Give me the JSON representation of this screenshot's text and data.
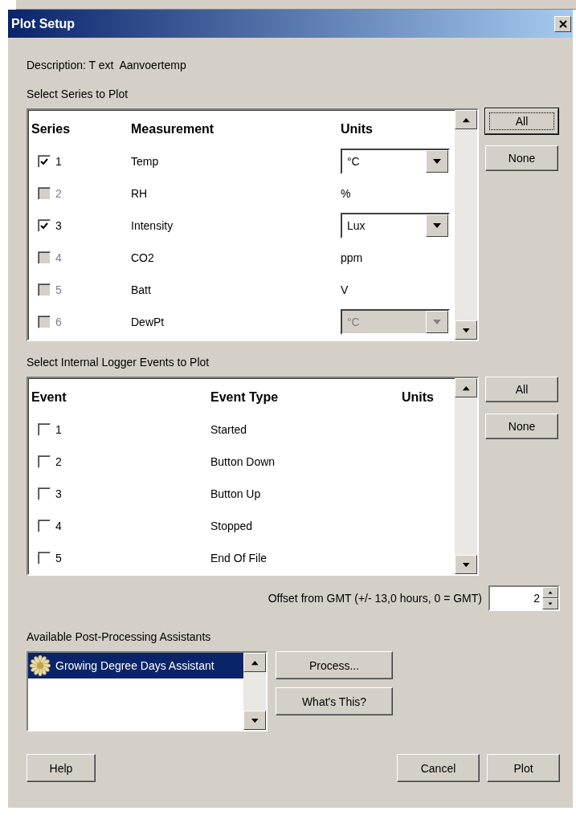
{
  "window": {
    "title": "Plot Setup"
  },
  "description": "Description: T ext  Aanvoertemp",
  "series_section": {
    "label": "Select Series to Plot",
    "columns": [
      "Series",
      "Measurement",
      "Units"
    ],
    "rows": [
      {
        "number": "1",
        "checked": true,
        "disabled": false,
        "measurement": "Temp",
        "units": "°C",
        "kind": "dropdown"
      },
      {
        "number": "2",
        "checked": false,
        "disabled": true,
        "measurement": "RH",
        "units": "%",
        "kind": "text"
      },
      {
        "number": "3",
        "checked": true,
        "disabled": false,
        "measurement": "Intensity",
        "units": "Lux",
        "kind": "dropdown"
      },
      {
        "number": "4",
        "checked": false,
        "disabled": true,
        "measurement": "CO2",
        "units": "ppm",
        "kind": "text"
      },
      {
        "number": "5",
        "checked": false,
        "disabled": true,
        "measurement": "Batt",
        "units": "V",
        "kind": "text"
      },
      {
        "number": "6",
        "checked": false,
        "disabled": true,
        "measurement": "DewPt",
        "units": "°C",
        "kind": "dropdown"
      }
    ],
    "buttons": [
      {
        "label": "All",
        "focused": true
      },
      {
        "label": "None",
        "focused": false
      }
    ]
  },
  "events_section": {
    "label": "Select Internal Logger Events to Plot",
    "columns": [
      "Event",
      "Event Type",
      "Units"
    ],
    "rows": [
      {
        "number": "1",
        "checked": false,
        "type": "Started"
      },
      {
        "number": "2",
        "checked": false,
        "type": "Button Down"
      },
      {
        "number": "3",
        "checked": false,
        "type": "Button Up"
      },
      {
        "number": "4",
        "checked": false,
        "type": "Stopped"
      },
      {
        "number": "5",
        "checked": false,
        "type": "End Of File"
      }
    ],
    "buttons": [
      {
        "label": "All",
        "focused": false
      },
      {
        "label": "None",
        "focused": false
      }
    ]
  },
  "gmt_offset": {
    "label": "Offset from GMT (+/- 13,0 hours, 0 = GMT)",
    "value": "2"
  },
  "assistants": {
    "label": "Available Post-Processing Assistants",
    "items": [
      {
        "name": "Growing Degree Days Assistant",
        "selected": true
      }
    ],
    "buttons": [
      "Process...",
      "What's This?"
    ]
  },
  "footer": {
    "left_buttons": [
      "Help"
    ],
    "right_buttons": [
      "Cancel",
      "Plot"
    ]
  }
}
